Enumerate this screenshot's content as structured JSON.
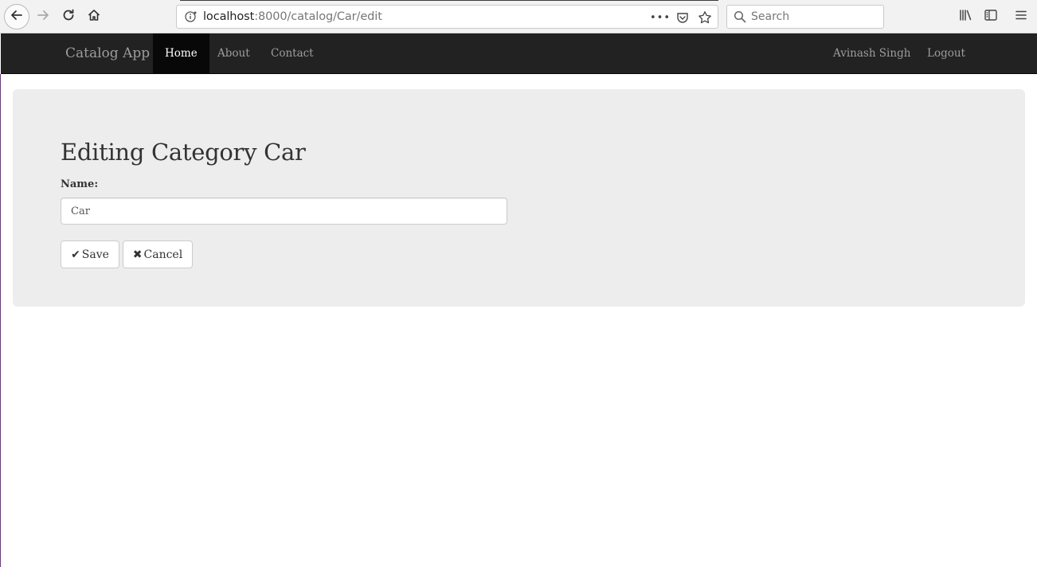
{
  "browser": {
    "url_host": "localhost",
    "url_rest": ":8000/catalog/Car/edit",
    "search_placeholder": "Search",
    "page_actions_icon": "•••"
  },
  "navbar": {
    "brand": "Catalog App",
    "items": [
      {
        "label": "Home",
        "active": true
      },
      {
        "label": "About",
        "active": false
      },
      {
        "label": "Contact",
        "active": false
      }
    ],
    "user_name": "Avinash Singh",
    "logout_label": "Logout"
  },
  "main": {
    "title": "Editing Category Car",
    "name_label": "Name:",
    "name_value": "Car",
    "save_label": "Save",
    "save_icon": "✔",
    "cancel_label": "Cancel",
    "cancel_icon": "✖"
  },
  "colors": {
    "navbar_bg": "#222222",
    "navbar_active_bg": "#080808",
    "navbar_text": "#9d9d9d",
    "jumbotron_bg": "#ededed"
  }
}
